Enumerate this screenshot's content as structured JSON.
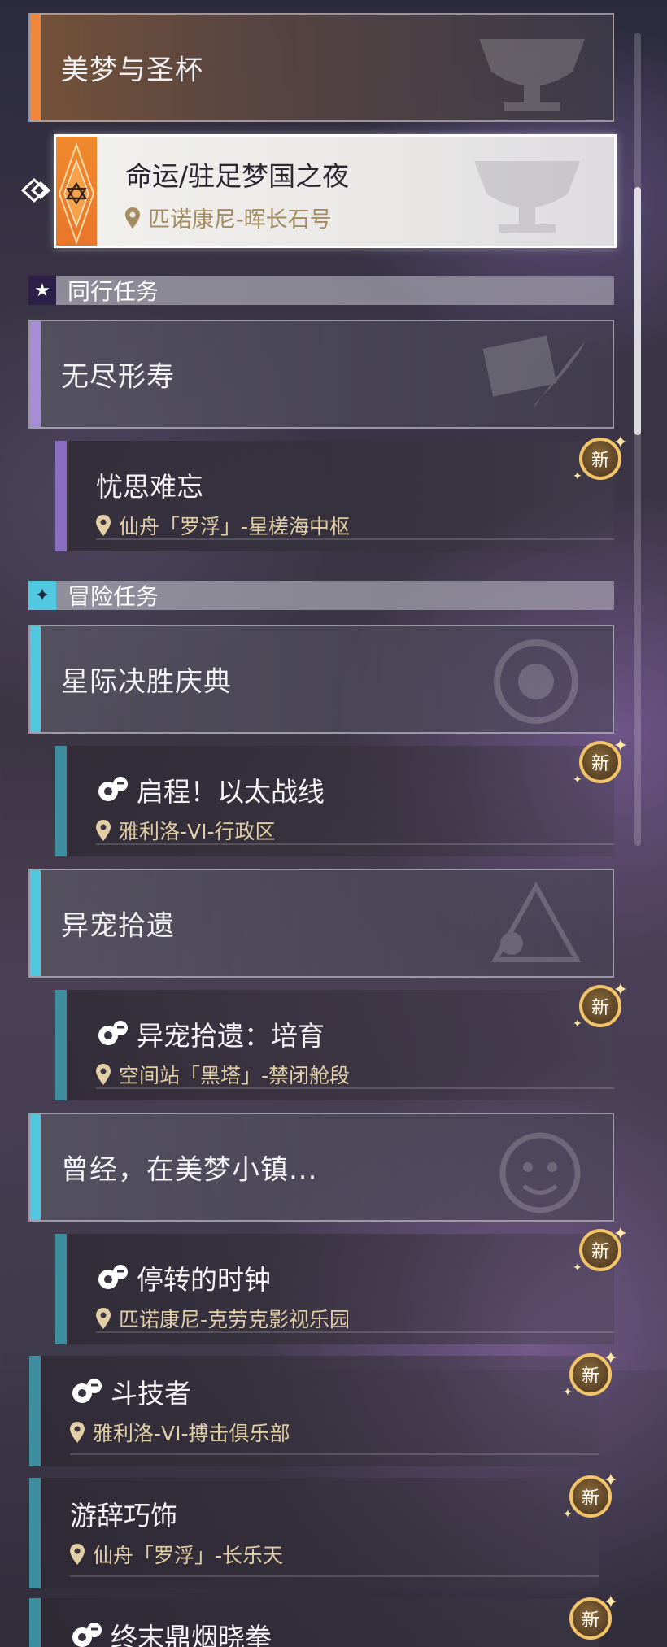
{
  "colors": {
    "main_stripe": "#f0863a",
    "companion_bar": "#a78cd8",
    "adventure_bar": "#4fc8e0",
    "location_gold": "#e2cfa6",
    "badge_ring": "#f2c46a"
  },
  "main_quest": {
    "group_title": "美梦与圣杯",
    "selected": {
      "title": "命运/驻足梦国之夜",
      "location": "匹诺康尼-晖长石号"
    }
  },
  "companion_section": {
    "label": "同行任务",
    "icon": "star-icon",
    "groups": [
      {
        "title": "无尽形寿",
        "quests": [
          {
            "title": "忧思难忘",
            "location": "仙舟「罗浮」-星槎海中枢",
            "badge": "新"
          }
        ]
      }
    ]
  },
  "adventure_section": {
    "label": "冒险任务",
    "icon": "sparkle-icon",
    "groups": [
      {
        "title": "星际决胜庆典",
        "quests": [
          {
            "title": "启程！以太战线",
            "location": "雅利洛-VI-行政区",
            "badge": "新",
            "icon": "pet-icon"
          }
        ]
      },
      {
        "title": "异宠拾遗",
        "quests": [
          {
            "title": "异宠拾遗：培育",
            "location": "空间站「黑塔」-禁闭舱段",
            "badge": "新",
            "icon": "pet-icon"
          }
        ]
      },
      {
        "title": "曾经，在美梦小镇...",
        "quests": [
          {
            "title": "停转的时钟",
            "location": "匹诺康尼-克劳克影视乐园",
            "badge": "新",
            "icon": "pet-icon"
          }
        ]
      }
    ],
    "loose_quests": [
      {
        "title": "斗技者",
        "location": "雅利洛-VI-搏击俱乐部",
        "badge": "新",
        "icon": "pet-icon"
      },
      {
        "title": "游辞巧饰",
        "location": "仙舟「罗浮」-长乐天",
        "badge": "新"
      },
      {
        "title": "终末鼎烟晓拳",
        "badge": "新",
        "icon": "pet-icon"
      }
    ]
  }
}
